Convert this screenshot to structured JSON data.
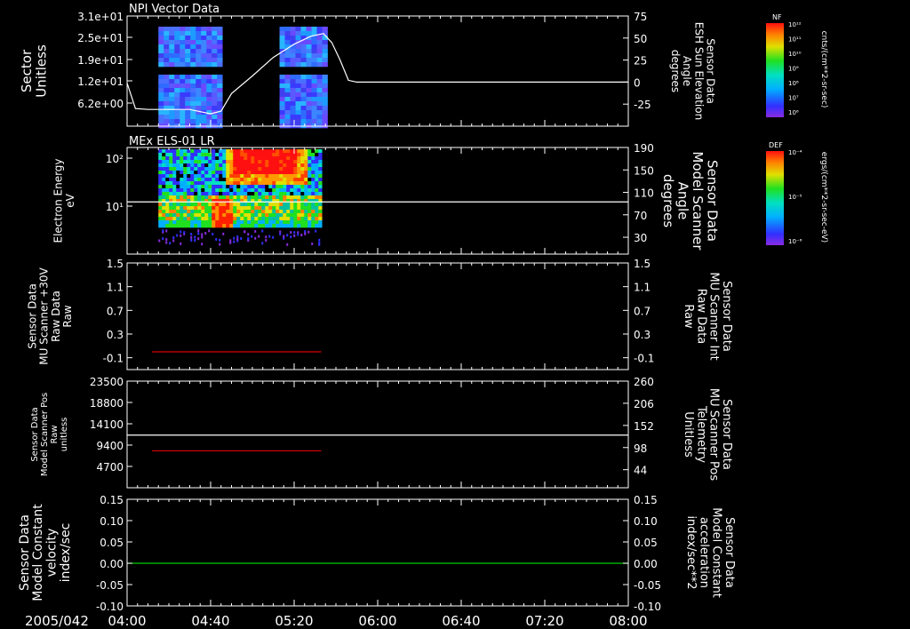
{
  "chart_data": [
    {
      "type": "heatmap",
      "title": "NPI Vector Data",
      "ylabel": [
        "Sector",
        "Unitless"
      ],
      "yticks": [
        "3.1e+01",
        "2.5e+01",
        "1.9e+01",
        "1.2e+01",
        "6.2e+00"
      ],
      "y2label": [
        "Sensor Data",
        "ESH Sun Elevation",
        "Angle",
        "degrees"
      ],
      "y2ticks": [
        "75",
        "50",
        "25",
        "0",
        "-25"
      ],
      "y2lim": [
        -50,
        75
      ],
      "overlay": {
        "color": "#ffffff",
        "x": [
          "04:00",
          "04:04",
          "04:10",
          "04:30",
          "04:40",
          "04:45",
          "04:50",
          "05:00",
          "05:10",
          "05:20",
          "05:28",
          "05:34",
          "05:38",
          "05:42",
          "05:46",
          "05:50",
          "06:00",
          "08:00"
        ],
        "y": [
          -1,
          -30,
          -31,
          -31,
          -36,
          -33,
          -13,
          7,
          28,
          43,
          52,
          55,
          45,
          25,
          2,
          0,
          0,
          0
        ]
      },
      "data_intervals": [
        [
          "04:15",
          "04:46"
        ],
        [
          "05:13",
          "05:35"
        ]
      ],
      "colorbar": {
        "label": "NF",
        "units": "cnts/(cm**2-sr-sec)",
        "scale": "log",
        "ticks": [
          "10¹²",
          "10¹¹",
          "10¹⁰",
          "10⁹",
          "10⁸",
          "10⁷",
          "10⁶"
        ]
      }
    },
    {
      "type": "heatmap",
      "title": "MEx ELS-01 LR",
      "ylabel": [
        "Electron Energy",
        "eV"
      ],
      "yticks": [
        "10²",
        "10¹"
      ],
      "y2label": [
        "Sensor Data",
        "Model Scanner",
        "Angle",
        "degrees"
      ],
      "y2ticks": [
        "190",
        "150",
        "110",
        "70",
        "30"
      ],
      "y2lim": [
        0,
        190
      ],
      "overlay": {
        "color": "#ffffff",
        "x": [
          "04:00",
          "08:00"
        ],
        "y": [
          93,
          93
        ]
      },
      "data_interval": [
        "04:15",
        "05:33"
      ],
      "colorbar": {
        "label": "DEF",
        "units": "ergs/(cm**2-sr-sec-eV)",
        "scale": "log",
        "ticks": [
          "10⁻⁴",
          "10⁻⁵",
          "10⁻⁶"
        ]
      }
    },
    {
      "type": "line",
      "ylabel": [
        "Sensor Data",
        "MU Scanner +30V",
        "Raw Data",
        "Raw"
      ],
      "yticks": [
        "1.5",
        "1.1",
        "0.7",
        "0.3",
        "-0.1"
      ],
      "ylim": [
        -0.3,
        1.5
      ],
      "y2label": [
        "Sensor Data",
        "MU Scanner Int",
        "Raw Data",
        "Raw"
      ],
      "y2ticks": [
        "1.5",
        "1.1",
        "0.7",
        "0.3",
        "-0.1"
      ],
      "series": [
        {
          "color": "#dd0000",
          "x": [
            "04:12",
            "05:33"
          ],
          "y": [
            0.0,
            0.0
          ]
        }
      ]
    },
    {
      "type": "line",
      "ylabel": [
        "Sensor Data",
        "Model Scanner Pos",
        "Raw",
        "unitless"
      ],
      "yticks": [
        "23500",
        "18800",
        "14100",
        "9400",
        "4700"
      ],
      "ylim": [
        0,
        23500
      ],
      "y2label": [
        "Sensor Data",
        "MU Scanner Pos",
        "Telemetry",
        "Unitless"
      ],
      "y2ticks": [
        "260",
        "206",
        "152",
        "98",
        "44"
      ],
      "y2lim": [
        0,
        260
      ],
      "series": [
        {
          "color": "#ffffff",
          "axis": "left",
          "x": [
            "04:00",
            "08:00"
          ],
          "y": [
            11600,
            11600
          ]
        },
        {
          "color": "#dd0000",
          "axis": "right",
          "x": [
            "04:12",
            "05:33"
          ],
          "y": [
            90,
            90
          ]
        }
      ]
    },
    {
      "type": "line",
      "ylabel": [
        "Sensor Data",
        "Model Constant",
        "velocity",
        "index/sec"
      ],
      "yticks": [
        "0.15",
        "0.10",
        "0.05",
        "0.00",
        "-0.05",
        "-0.10"
      ],
      "ylim": [
        -0.1,
        0.15
      ],
      "y2label": [
        "Sensor Data",
        "Model Constant",
        "acceleration",
        "index/sec**2"
      ],
      "y2ticks": [
        "0.15",
        "0.10",
        "0.05",
        "0.00",
        "-0.05",
        "-0.10"
      ],
      "series": [
        {
          "color": "#00cc00",
          "x": [
            "04:00",
            "08:00"
          ],
          "y": [
            0.0,
            0.0
          ]
        }
      ]
    }
  ],
  "time_axis": {
    "date": "2005/042",
    "ticks": [
      "04:00",
      "04:40",
      "05:20",
      "06:00",
      "06:40",
      "07:20",
      "08:00"
    ]
  }
}
